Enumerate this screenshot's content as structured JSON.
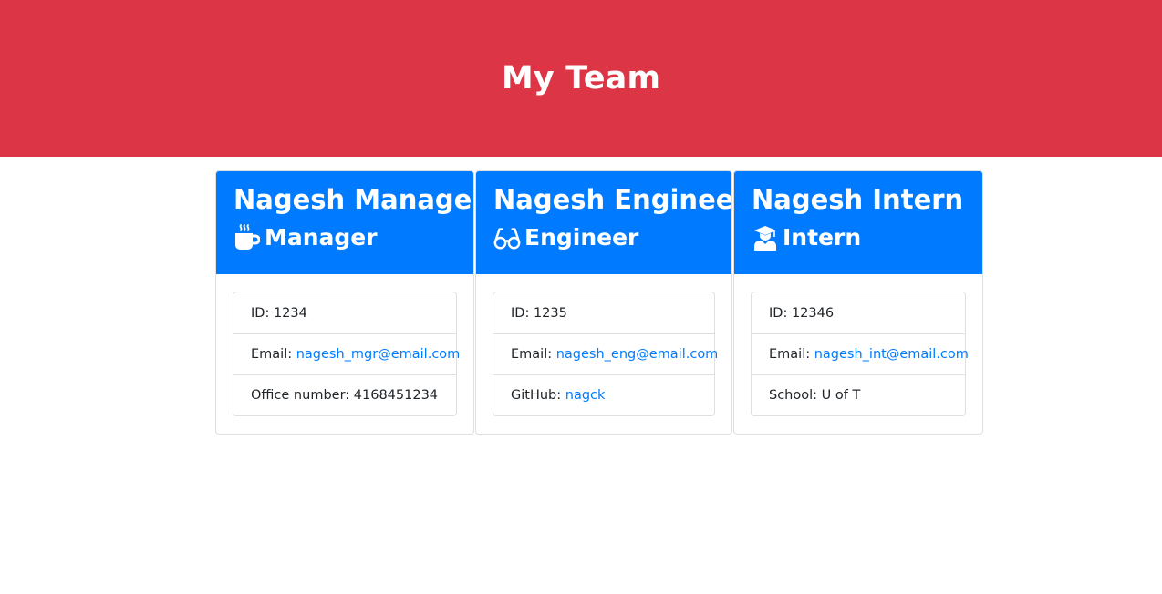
{
  "header": {
    "title": "My Team"
  },
  "colors": {
    "header_bg": "#dc3545",
    "card_header_bg": "#007bff",
    "link": "#007bff"
  },
  "cards": [
    {
      "name": "Nagesh Manager",
      "role": "Manager",
      "role_icon": "mug-icon",
      "id_label": "ID:",
      "id_value": "1234",
      "email_label": "Email:",
      "email": "nagesh_mgr@email.com",
      "extra_label": "Office number:",
      "extra_value": "4168451234"
    },
    {
      "name": "Nagesh Engineer",
      "role": "Engineer",
      "role_icon": "glasses-icon",
      "id_label": "ID:",
      "id_value": "1235",
      "email_label": "Email:",
      "email": "nagesh_eng@email.com",
      "extra_label": "GitHub:",
      "extra_value": "nagck"
    },
    {
      "name": "Nagesh Intern",
      "role": "Intern",
      "role_icon": "graduate-icon",
      "id_label": "ID:",
      "id_value": "12346",
      "email_label": "Email:",
      "email": "nagesh_int@email.com",
      "extra_label": "School:",
      "extra_value": "U of T"
    }
  ]
}
